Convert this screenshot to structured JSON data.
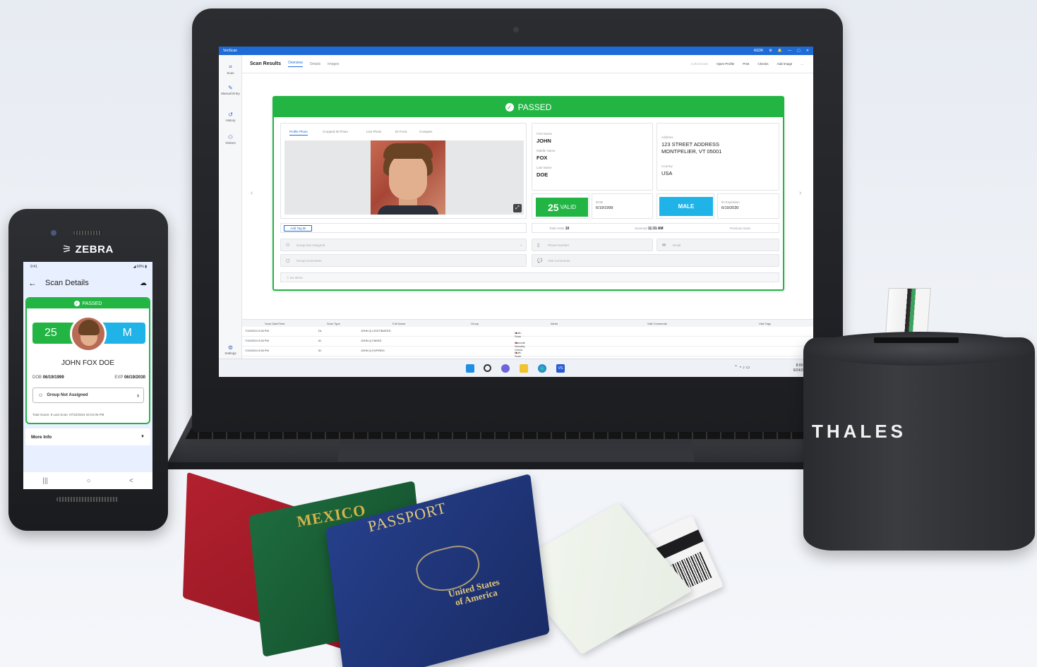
{
  "laptop": {
    "app_title": "VeriScan",
    "titlebar_user": "ASDK",
    "titlebar_controls": [
      "⚙",
      "🔔",
      "—",
      "▢",
      "✕"
    ],
    "rail": [
      {
        "icon": "scan-icon",
        "label": "Scan"
      },
      {
        "icon": "manual-entry-icon",
        "label": "Manual Entry"
      },
      {
        "icon": "history-icon",
        "label": "History"
      },
      {
        "icon": "visitors-icon",
        "label": "Visitors"
      },
      {
        "icon": "settings-icon",
        "label": "Settings"
      }
    ],
    "toolbar": {
      "title": "Scan Results",
      "tabs": [
        "Overview",
        "Details",
        "Images"
      ],
      "actions": [
        "Authenticate",
        "Open Profile",
        "Print",
        "Checks",
        "Add Image",
        "..."
      ]
    },
    "result": {
      "status": "PASSED",
      "photo_tabs": [
        "Profile Photo",
        "Cropped ID Photo",
        "Live Photo",
        "ID Front",
        "Compare"
      ],
      "first_name_label": "First Name",
      "first_name": "JOHN",
      "middle_name_label": "Middle Name",
      "middle_name": "FOX",
      "last_name_label": "Last Name",
      "last_name": "DOE",
      "address_label": "Address",
      "address_line1": "123 STREET ADDRESS",
      "address_line2": "MONTPELIER, VT 05001",
      "country_label": "Country",
      "country": "USA",
      "age": "25",
      "age_status": "VALID",
      "dob_label": "DOB",
      "dob": "6/19/1999",
      "sex": "MALE",
      "id_exp_label": "ID Expiration",
      "id_exp": "6/19/2030",
      "add_tag": "Add Tag",
      "total_visits_label": "Total Visits",
      "total_visits": "10",
      "scanned_label": "Scanned",
      "scanned": "11:31 AM",
      "previous_scan_label": "Previous Scan",
      "group_placeholder": "Group Not Assigned",
      "phone_placeholder": "Phone Number",
      "email_placeholder": "Email",
      "group_comments_placeholder": "Group Comments",
      "visit_comments_placeholder": "Visit Comments",
      "alerts": "No alerts"
    },
    "table": {
      "headers": [
        "Scan Date/Time",
        "Scan Type",
        "Full Name",
        "Group",
        "Alerts",
        "Visit Comments",
        "Visit Tags"
      ],
      "rows": [
        {
          "date": "7/19/2024 3:06 PM",
          "type": "DL",
          "name": "JOHN Q LEGITIMATED",
          "alert": "Multi-Scan"
        },
        {
          "date": "7/19/2024 3:06 PM",
          "type": "ID",
          "name": "JOHN Q FAKED",
          "alert": "Barcode Security Check"
        },
        {
          "date": "7/19/2024 3:06 PM",
          "type": "ID",
          "name": "JOHN Q EXPIRED",
          "alert": "Multi-Scan"
        }
      ]
    },
    "taskbar": {
      "time": "8:00 AM",
      "date": "6/24/2024"
    }
  },
  "phone": {
    "brand": "ZEBRA",
    "status_time": "9:41",
    "status_battery": "60%",
    "header_title": "Scan Details",
    "status": "PASSED",
    "age": "25",
    "sex": "M",
    "full_name": "JOHN FOX DOE",
    "dob_label": "DOB",
    "dob": "06/19/1999",
    "exp_label": "EXP",
    "exp": "06/19/2030",
    "group": "Group Not Assigned",
    "footer": "Total Scans: 9    Last Scan: 07/22/2024 02:04:06 PM",
    "more_info": "More Info",
    "nav": [
      "|||",
      "○",
      "<"
    ]
  },
  "reader": {
    "brand": "THALES"
  },
  "documents": {
    "mexico": "MEXICO",
    "passport": "PASSPORT",
    "usa_line1": "United States",
    "usa_line2": "of America"
  }
}
